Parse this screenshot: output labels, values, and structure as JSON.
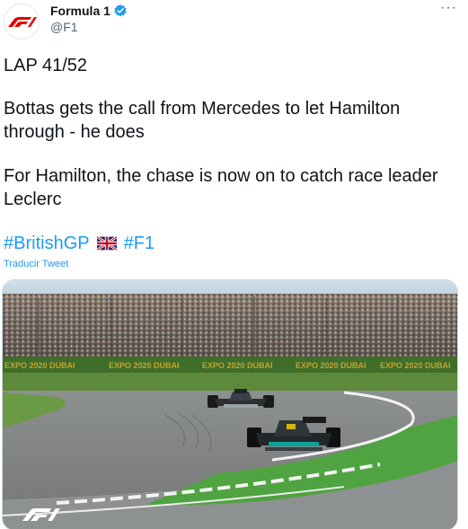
{
  "author": {
    "name": "Formula 1",
    "handle": "@F1",
    "avatar_icon": "f1-logo-icon",
    "verified_icon": "verified-badge-icon"
  },
  "more_icon": "more-options-icon",
  "tweet": {
    "lap": "LAP 41/52",
    "para1_line1": "Bottas gets the call from Mercedes to let Hamilton",
    "para1_line2": "through - he does",
    "para2_line1": "For Hamilton, the chase is now on to catch race leader",
    "para2_line2": "Leclerc",
    "hashtag1": "#BritishGP",
    "hashtag2": "#F1",
    "flag_icon": "uk-flag-icon"
  },
  "translate_label": "Traducir Tweet",
  "media": {
    "banner_text": "EXPO 2020 DUBAI",
    "watermark_icon": "f1-watermark-icon"
  },
  "colors": {
    "link": "#1d9bf0",
    "f1_red": "#e10600",
    "verified": "#1d9bf0"
  }
}
